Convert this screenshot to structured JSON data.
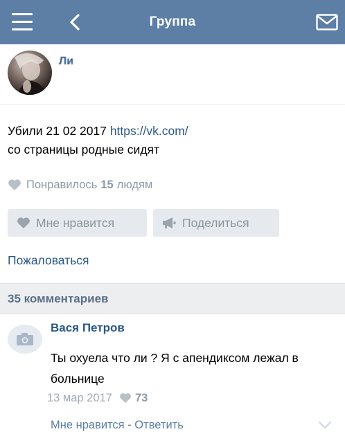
{
  "header": {
    "title": "Группа",
    "menu_icon": "menu-icon",
    "back_icon": "chevron-left-icon",
    "mail_icon": "mail-icon",
    "bg_color": "#5d7fa6"
  },
  "post": {
    "author_name": "Ли",
    "text_line1_prefix": "Убили 21 02 2017 ",
    "text_line1_link": "https://vk.com/",
    "text_line2": "со страницы родные сидят",
    "likes_prefix": "Понравилось",
    "likes_count": "15",
    "likes_suffix": "людям",
    "like_button_label": "Мне нравится",
    "share_button_label": "Поделиться",
    "report_label": "Пожаловаться"
  },
  "comments": {
    "header": "35 комментариев",
    "items": [
      {
        "author": "Вася Петров",
        "text": "Ты охуела что ли ? Я с апендиксом лежал в больнице",
        "date": "13 мар 2017",
        "likes": "73",
        "like_action": "Мне нравится",
        "separator": " - ",
        "reply_action": "Ответить"
      }
    ]
  },
  "colors": {
    "link": "#2a5885",
    "muted": "#8f99a3",
    "button_bg": "#e6eaee",
    "section_bg": "#edeef0"
  }
}
